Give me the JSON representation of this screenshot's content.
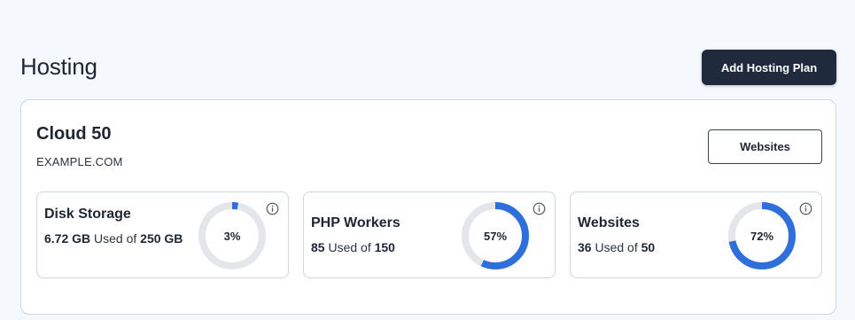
{
  "header": {
    "title": "Hosting",
    "add_button_label": "Add Hosting Plan"
  },
  "plan": {
    "name": "Cloud 50",
    "domain": "EXAMPLE.COM",
    "websites_button_label": "Websites",
    "metrics": [
      {
        "title": "Disk Storage",
        "used": "6.72 GB",
        "used_of_text": "Used of",
        "total": "250 GB",
        "percent_label": "3%",
        "percent": 3,
        "info_icon": "info-icon"
      },
      {
        "title": "PHP Workers",
        "used": "85",
        "used_of_text": "Used of",
        "total": "150",
        "percent_label": "57%",
        "percent": 57,
        "info_icon": "info-icon"
      },
      {
        "title": "Websites",
        "used": "36",
        "used_of_text": "Used of",
        "total": "50",
        "percent_label": "72%",
        "percent": 72,
        "info_icon": "info-icon"
      }
    ]
  },
  "colors": {
    "accent": "#2f6fdc",
    "track": "#e4e6ea",
    "primary_button": "#1f2a3c",
    "background": "#f5f8fc"
  }
}
